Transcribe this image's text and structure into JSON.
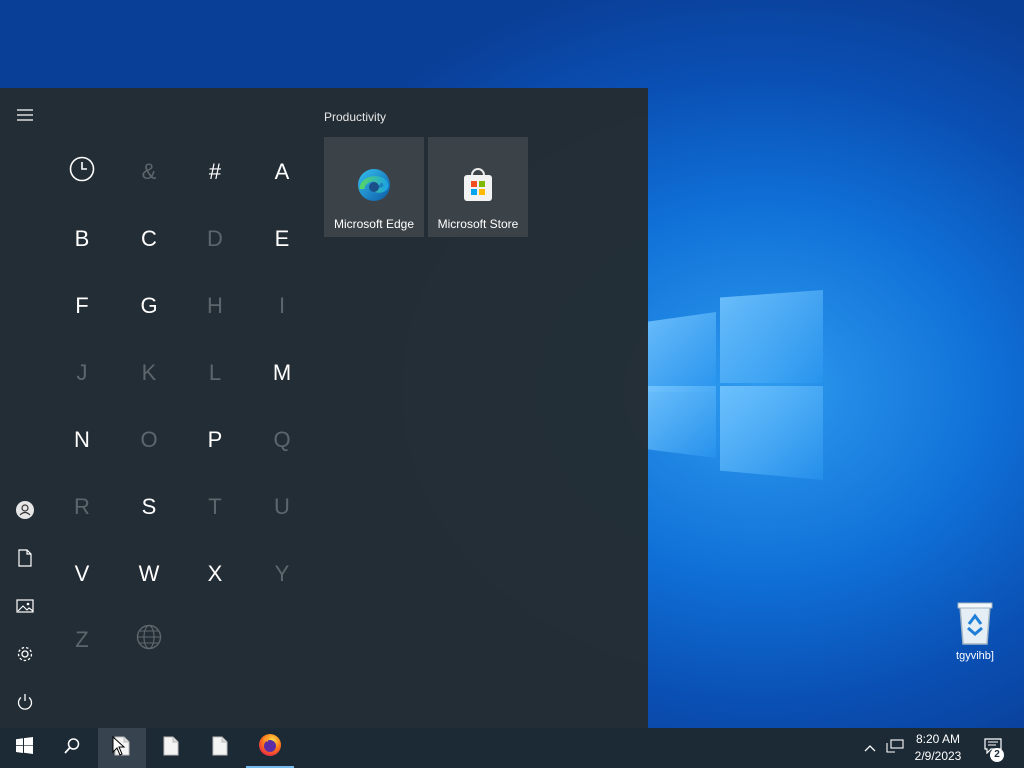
{
  "start_menu": {
    "tiles_group_title": "Productivity",
    "tiles": [
      {
        "label": "Microsoft Edge",
        "icon": "edge-icon"
      },
      {
        "label": "Microsoft Store",
        "icon": "store-icon"
      }
    ],
    "alphabet": [
      {
        "label": "",
        "icon": "clock-icon",
        "enabled": true
      },
      {
        "label": "&",
        "enabled": false
      },
      {
        "label": "#",
        "enabled": true
      },
      {
        "label": "A",
        "enabled": true
      },
      {
        "label": "B",
        "enabled": true
      },
      {
        "label": "C",
        "enabled": true
      },
      {
        "label": "D",
        "enabled": false
      },
      {
        "label": "E",
        "enabled": true
      },
      {
        "label": "F",
        "enabled": true
      },
      {
        "label": "G",
        "enabled": true
      },
      {
        "label": "H",
        "enabled": false
      },
      {
        "label": "I",
        "enabled": false
      },
      {
        "label": "J",
        "enabled": false
      },
      {
        "label": "K",
        "enabled": false
      },
      {
        "label": "L",
        "enabled": false
      },
      {
        "label": "M",
        "enabled": true
      },
      {
        "label": "N",
        "enabled": true
      },
      {
        "label": "O",
        "enabled": false
      },
      {
        "label": "P",
        "enabled": true
      },
      {
        "label": "Q",
        "enabled": false
      },
      {
        "label": "R",
        "enabled": false
      },
      {
        "label": "S",
        "enabled": true
      },
      {
        "label": "T",
        "enabled": false
      },
      {
        "label": "U",
        "enabled": false
      },
      {
        "label": "V",
        "enabled": true
      },
      {
        "label": "W",
        "enabled": true
      },
      {
        "label": "X",
        "enabled": true
      },
      {
        "label": "Y",
        "enabled": false
      },
      {
        "label": "Z",
        "enabled": false
      },
      {
        "label": "",
        "icon": "globe-icon",
        "enabled": false
      }
    ],
    "rail_icons": [
      "hamburger-icon",
      "user-icon",
      "document-icon",
      "pictures-icon",
      "settings-icon",
      "power-icon"
    ]
  },
  "desktop": {
    "icons": [
      {
        "label": "tgyvihb]",
        "icon": "recycle-bin-icon"
      }
    ]
  },
  "taskbar": {
    "items": [
      "start-icon",
      "search-icon",
      "file-icon",
      "file-icon",
      "file-icon",
      "firefox-icon"
    ],
    "tray": {
      "time": "8:20 AM",
      "date": "2/9/2023",
      "notification_count": "2"
    }
  },
  "colors": {
    "menu_bg": "#242c32",
    "tile_bg": "#3b4349",
    "taskbar_bg": "#1c2a36",
    "accent": "#0a6fd6"
  }
}
